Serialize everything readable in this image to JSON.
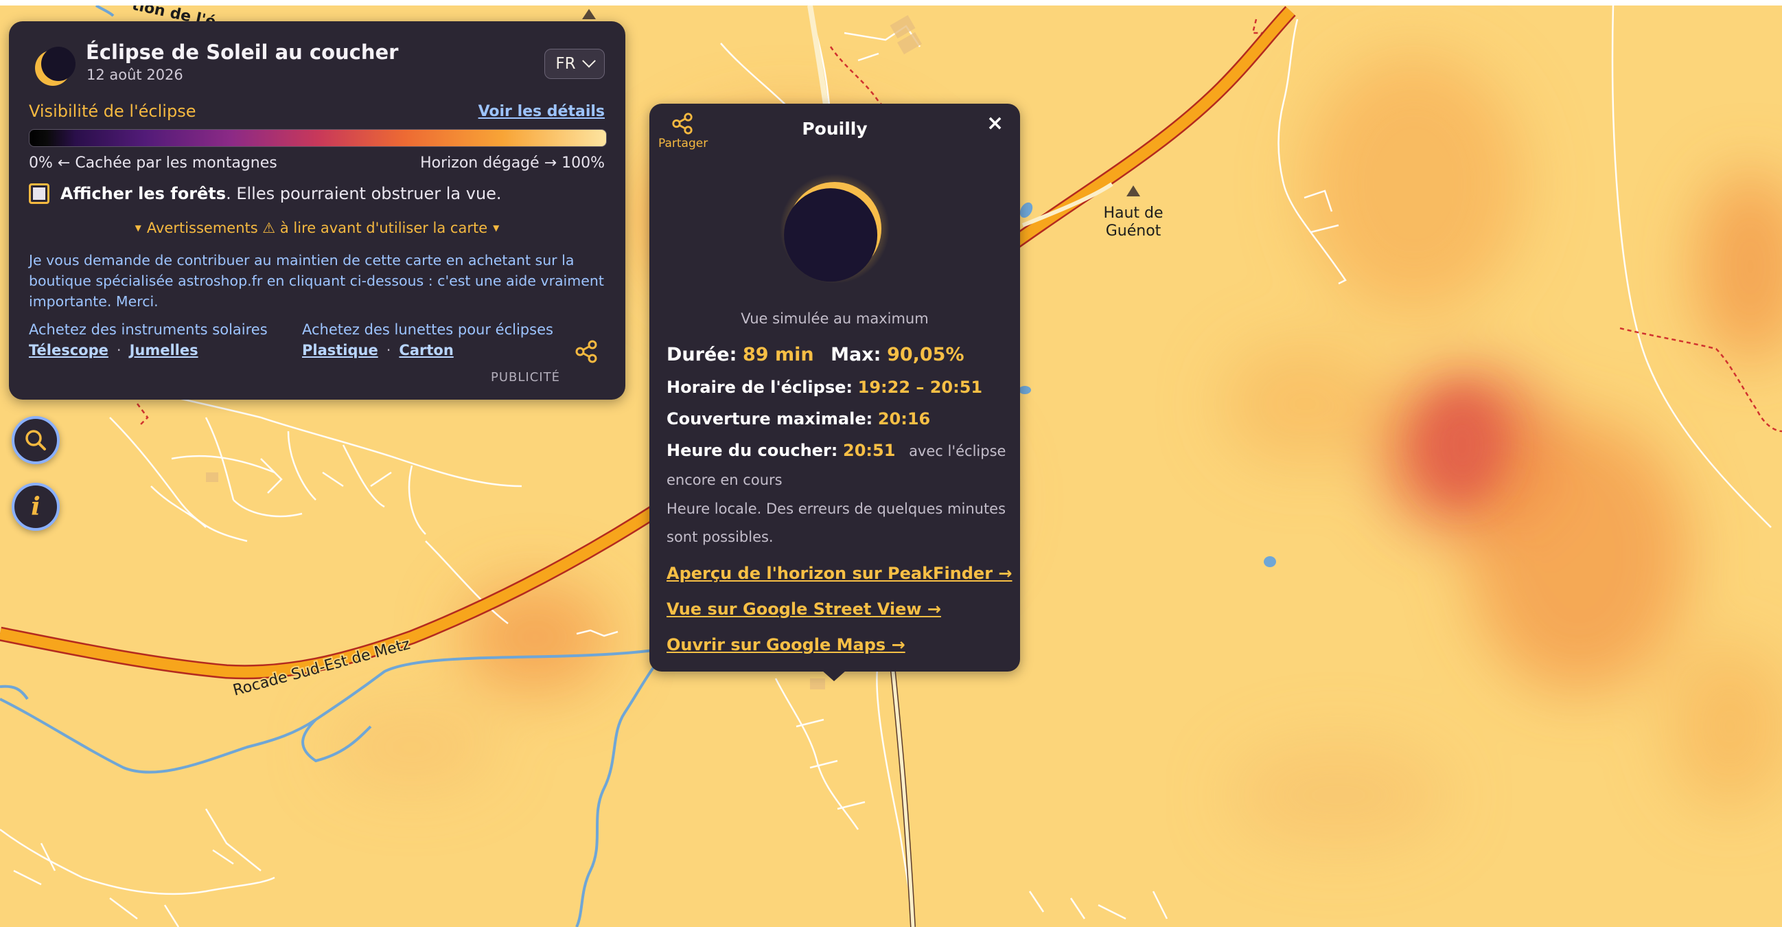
{
  "app": {
    "title": "Éclipse de Soleil au coucher",
    "date": "12 août 2026",
    "language": "FR"
  },
  "visibility": {
    "title": "Visibilité de l'éclipse",
    "details_link": "Voir les détails",
    "scale_min_label": "0% ← Cachée par les montagnes",
    "scale_max_label": "Horizon dégagé → 100%"
  },
  "forests": {
    "checked": false,
    "label_strong": "Afficher les forêts",
    "label_rest": ". Elles pourraient obstruer la vue."
  },
  "warnings": "Avertissements ⚠ à lire avant d'utiliser la carte",
  "support_text": "Je vous demande de contribuer au maintien de cette carte en achetant sur la boutique spécialisée astroshop.fr en cliquant ci-dessous : c'est une aide vraiment importante. Merci.",
  "shop": {
    "col1_title": "Achetez des instruments solaires",
    "col1_links": [
      "Télescope",
      "Jumelles"
    ],
    "col2_title": "Achetez des lunettes pour éclipses",
    "col2_links": [
      "Plastique",
      "Carton"
    ],
    "separator": "·",
    "ad_label": "PUBLICITÉ"
  },
  "popup": {
    "share_label": "Partager",
    "place": "Pouilly",
    "close": "×",
    "sim_caption": "Vue simulée au maximum",
    "duration_label": "Durée:",
    "duration_value": "89 min",
    "max_label": "Max:",
    "max_value": "90,05%",
    "max_fraction": 0.9005,
    "schedule_label": "Horaire de l'éclipse:",
    "schedule_value": "19:22 – 20:51",
    "max_coverage_label": "Couverture maximale:",
    "max_coverage_value": "20:16",
    "sunset_label": "Heure du coucher:",
    "sunset_value": "20:51",
    "sunset_note_1": "avec l'éclipse",
    "sunset_note_2": "encore en cours",
    "local_time_note_1": "Heure locale. Des erreurs de quelques minutes",
    "local_time_note_2": "sont possibles.",
    "links": [
      "Aperçu de l'horizon sur PeakFinder →",
      "Vue sur Google Street View →",
      "Ouvrir sur Google Maps →"
    ]
  },
  "map": {
    "road_label": "Rocade Sud-Est de Metz",
    "peak_label_1": "Haut de",
    "peak_label_2": "Guénot",
    "fragment_label": "tion de l'é"
  },
  "colors": {
    "panel_bg": "#2b2633",
    "accent": "#f5b940",
    "link": "#9dc4ff",
    "map_base": "#fcd57a",
    "road": "#f7a51c"
  }
}
